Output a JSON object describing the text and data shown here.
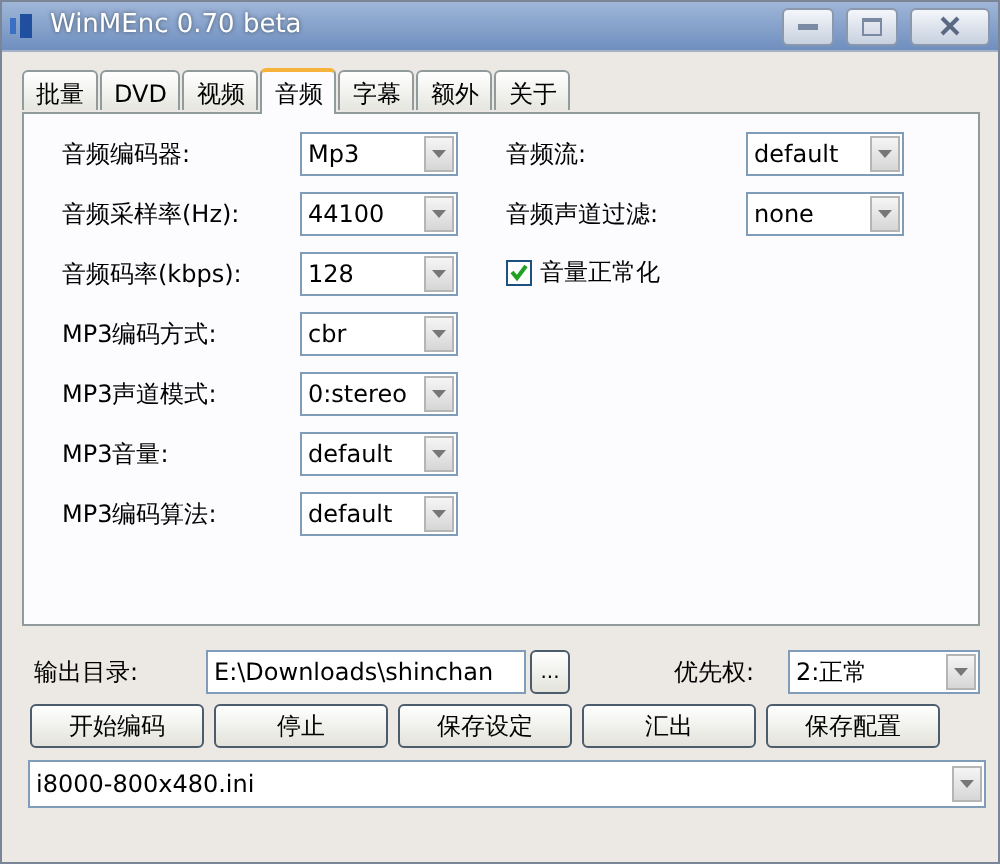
{
  "window": {
    "title": "WinMEnc 0.70 beta"
  },
  "tabs": [
    {
      "label": "批量",
      "selected": false
    },
    {
      "label": "DVD",
      "selected": false
    },
    {
      "label": "视频",
      "selected": false
    },
    {
      "label": "音频",
      "selected": true
    },
    {
      "label": "字幕",
      "selected": false
    },
    {
      "label": "额外",
      "selected": false
    },
    {
      "label": "关于",
      "selected": false
    }
  ],
  "left_settings": [
    {
      "label": "音频编码器:",
      "value": "Mp3"
    },
    {
      "label": "音频采样率(Hz):",
      "value": "44100"
    },
    {
      "label": "音频码率(kbps):",
      "value": "128"
    },
    {
      "label": "MP3编码方式:",
      "value": "cbr"
    },
    {
      "label": "MP3声道模式:",
      "value": "0:stereo"
    },
    {
      "label": "MP3音量:",
      "value": "default"
    },
    {
      "label": "MP3编码算法:",
      "value": "default"
    }
  ],
  "right_settings": [
    {
      "label": "音频流:",
      "value": "default"
    },
    {
      "label": "音频声道过滤:",
      "value": "none"
    }
  ],
  "normalize": {
    "label": "音量正常化",
    "checked": true
  },
  "output_dir": {
    "label": "输出目录:",
    "value": "E:\\Downloads\\shinchan",
    "browse": "..."
  },
  "priority": {
    "label": "优先权:",
    "value": "2:正常"
  },
  "buttons": [
    "开始编码",
    "停止",
    "保存设定",
    "汇出",
    "保存配置"
  ],
  "profile": {
    "value": "i8000-800x480.ini"
  }
}
